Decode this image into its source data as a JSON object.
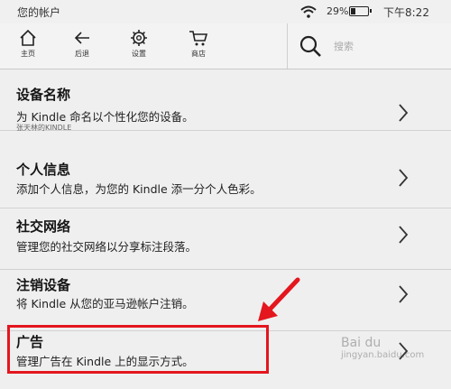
{
  "status_bar": {
    "title": "您的帐户",
    "battery_percent": "29%",
    "battery_level": 0.29,
    "time": "下午8:22"
  },
  "toolbar": {
    "home_label": "主页",
    "back_label": "后退",
    "settings_label": "设置",
    "store_label": "商店",
    "search_placeholder": "搜索"
  },
  "settings_list": [
    {
      "title": "设备名称",
      "desc": "为 Kindle 命名以个性化您的设备。",
      "sub": "张天林的KINDLE"
    },
    {
      "title": "个人信息",
      "desc": "添加个人信息，为您的 Kindle 添一分个人色彩。"
    },
    {
      "title": "社交网络",
      "desc": "管理您的社交网络以分享标注段落。"
    },
    {
      "title": "注销设备",
      "desc": "将 Kindle 从您的亚马逊帐户注销。"
    },
    {
      "title": "广告",
      "desc": "管理广告在 Kindle 上的显示方式。"
    }
  ],
  "watermark": {
    "line1": "Bai du",
    "line2": "jingyan.baidu.com"
  },
  "colors": {
    "highlight": "#e4161e",
    "background": "#efefef"
  }
}
